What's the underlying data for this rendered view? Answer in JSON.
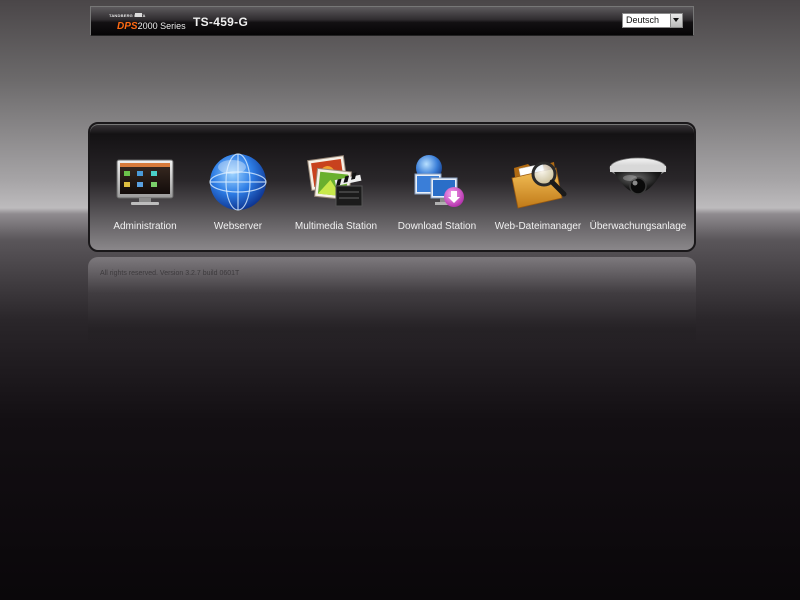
{
  "header": {
    "brand_top": "TANDBERG DATA",
    "brand_code": "DPS",
    "brand_series": "2000 Series",
    "model": "TS-459-G"
  },
  "language": {
    "selected": "Deutsch"
  },
  "apps": [
    {
      "label": "Administration",
      "icon": "monitor-icon"
    },
    {
      "label": "Webserver",
      "icon": "globe-icon"
    },
    {
      "label": "Multimedia Station",
      "icon": "media-icon"
    },
    {
      "label": "Download Station",
      "icon": "download-icon"
    },
    {
      "label": "Web-Dateimanager",
      "icon": "folder-search-icon"
    },
    {
      "label": "Überwachungsanlage",
      "icon": "camera-icon"
    }
  ],
  "footer": {
    "copyright": "All rights reserved. Version 3.2.7 build 0601T"
  },
  "colors": {
    "brand_accent": "#ff6a13"
  }
}
